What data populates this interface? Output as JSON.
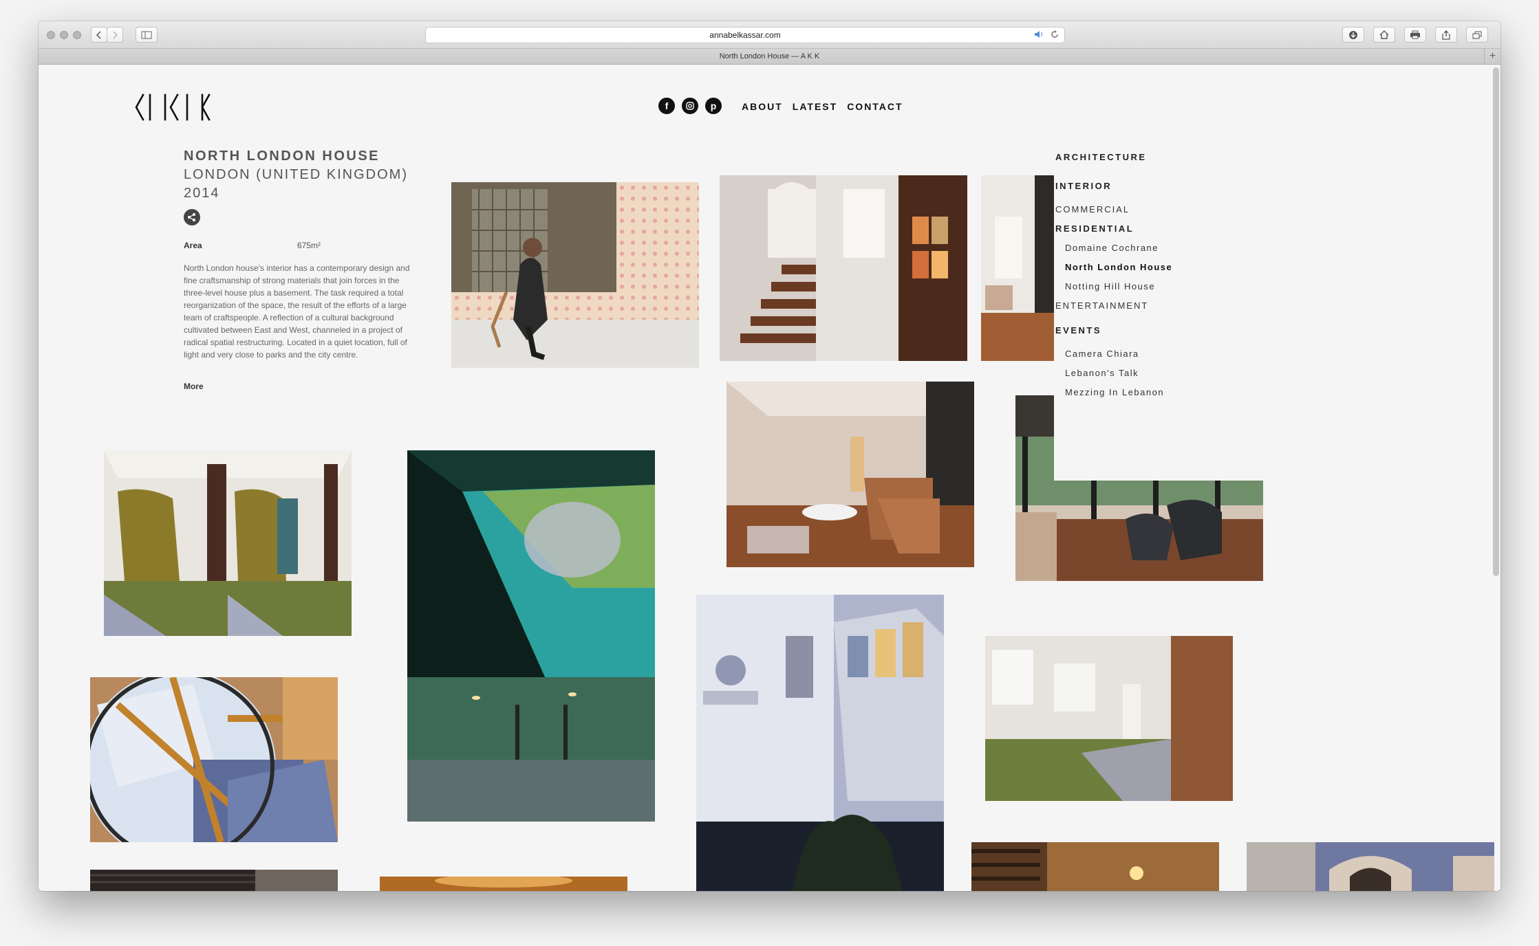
{
  "browser": {
    "url": "annabelkassar.com",
    "tab_title": "North London House — A K K"
  },
  "site": {
    "nav": [
      "ABOUT",
      "LATEST",
      "CONTACT"
    ],
    "social": [
      "facebook-icon",
      "instagram-icon",
      "pinterest-icon"
    ]
  },
  "project": {
    "title": "NORTH LONDON HOUSE",
    "location": "LONDON (UNITED KINGDOM)",
    "year": "2014",
    "area_label": "Area",
    "area_value": "675m²",
    "description": "North London house's interior has a contemporary design and fine craftsmanship of strong materials that join forces in the three-level house plus a basement. The task required a total reorganization of the space, the result of the efforts of a large team of craftspeople. A reflection of a cultural background cultivated between East and West, channeled in a project of radical spatial restructuring. Located in a quiet location, full of light and very close to parks and the city centre.",
    "more": "More"
  },
  "sidebar": {
    "architecture": "ARCHITECTURE",
    "interior": "INTERIOR",
    "commercial": "COMMERCIAL",
    "residential": "RESIDENTIAL",
    "residential_items": [
      "Domaine Cochrane",
      "North London House",
      "Notting Hill House"
    ],
    "entertainment": "ENTERTAINMENT",
    "events": "EVENTS",
    "events_items": [
      "Camera Chiara",
      "Lebanon's Talk",
      "Mezzing In Lebanon"
    ]
  },
  "colors": {
    "accent": "#111111",
    "text_muted": "#666666"
  }
}
